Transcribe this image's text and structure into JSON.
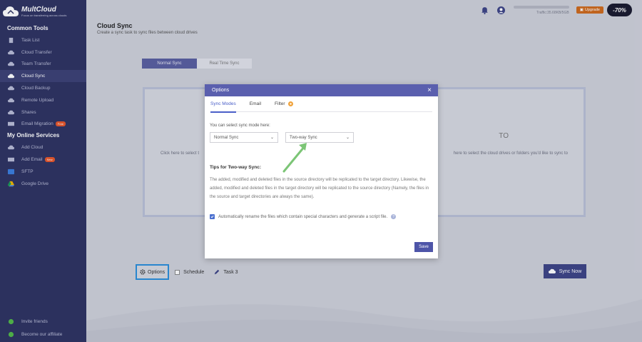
{
  "logo": {
    "brand": "MultCloud",
    "tagline": "Focus on transferring across clouds"
  },
  "sidebar": {
    "common_title": "Common Tools",
    "common_items": [
      {
        "label": "Task List"
      },
      {
        "label": "Cloud Transfer"
      },
      {
        "label": "Team Transfer"
      },
      {
        "label": "Cloud Sync"
      },
      {
        "label": "Cloud Backup"
      },
      {
        "label": "Remote Upload"
      },
      {
        "label": "Shares"
      },
      {
        "label": "Email Migration",
        "badge": "Free"
      }
    ],
    "services_title": "My Online Services",
    "service_items": [
      {
        "label": "Add Cloud"
      },
      {
        "label": "Add Email",
        "badge": "New"
      },
      {
        "label": "SFTP"
      },
      {
        "label": "Google Drive"
      }
    ],
    "bottom_items": [
      {
        "label": "Invite friends"
      },
      {
        "label": "Become our affiliate"
      }
    ]
  },
  "header": {
    "traffic": "Traffic:35.68KB/5GB",
    "upgrade": "Upgrade",
    "promo": "-70%"
  },
  "page": {
    "title": "Cloud Sync",
    "subtitle": "Create a sync task to sync files between cloud drives",
    "tabs": [
      {
        "label": "Normal Sync"
      },
      {
        "label": "Real Time Sync"
      }
    ],
    "from_text": "Click here to select t",
    "to_label": "TO",
    "to_text": "here to select the cloud drives or folders you'd like to sync to"
  },
  "bottom": {
    "options": "Options",
    "schedule": "Schedule",
    "task": "Task 3",
    "sync_now": "Sync Now"
  },
  "modal": {
    "title": "Options",
    "close": "×",
    "tabs": [
      {
        "label": "Sync Modes"
      },
      {
        "label": "Email"
      },
      {
        "label": "Filter"
      }
    ],
    "mode_label": "You can select sync mode here:",
    "select_a": "Normal Sync",
    "select_b": "Two-way Sync",
    "tips_title": "Tips for Two-way Sync:",
    "tips_body": "The added, modified and deleted files in the source directory will be replicated to the target directory. Likewise, the added, modified and deleted files in the target directory will be replicated to the source directory (Namely, the files in the source and target directories are always the same).",
    "auto_rename": "Automatically rename the files which contain special characters and generate a script file.",
    "save": "Save"
  },
  "colors": {
    "sidebar": "#2e3261",
    "accent": "#5a5fae",
    "arrow": "#7cc576"
  }
}
